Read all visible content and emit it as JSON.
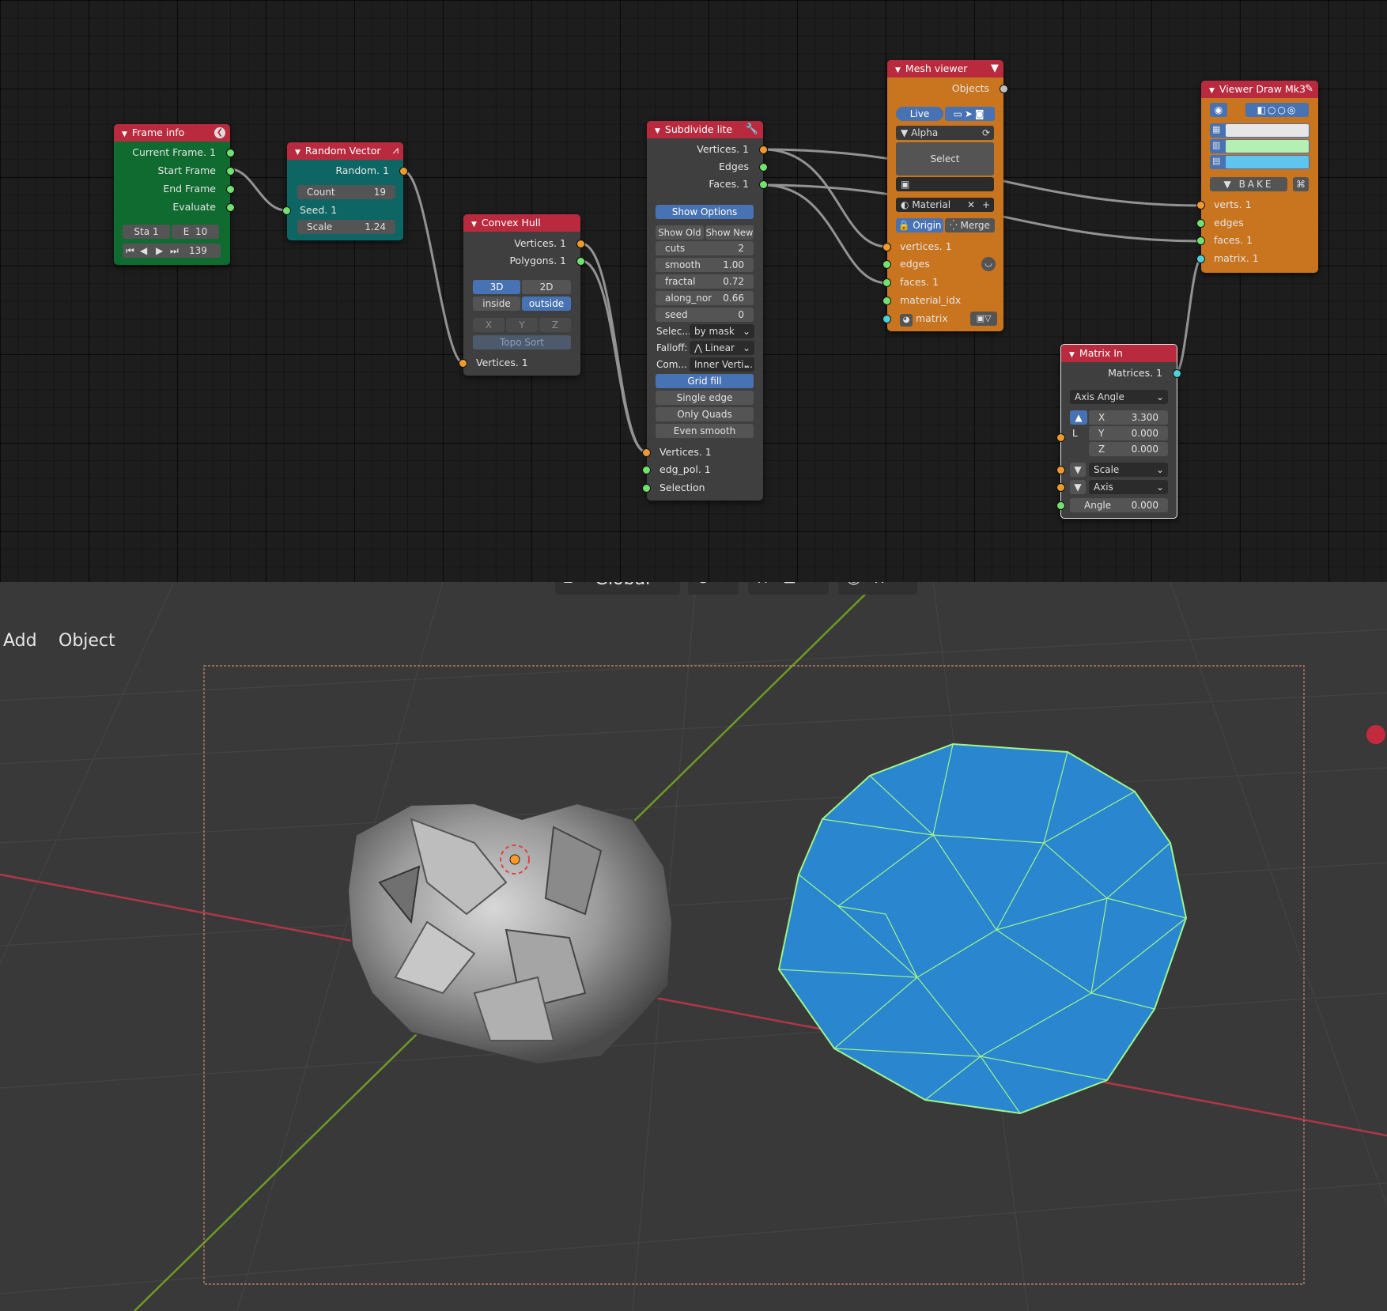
{
  "nodes": {
    "frame_info": {
      "title": "Frame info",
      "outputs": [
        "Current Frame. 1",
        "Start Frame",
        "End Frame",
        "Evaluate"
      ],
      "start_label": "Sta",
      "start_value": "1",
      "end_label": "E",
      "end_value": "10",
      "frame_value": "139"
    },
    "random_vector": {
      "title": "Random Vector",
      "output": "Random. 1",
      "count_label": "Count",
      "count_value": "19",
      "seed": "Seed. 1",
      "scale_label": "Scale",
      "scale_value": "1.24"
    },
    "convex_hull": {
      "title": "Convex Hull",
      "outputs": [
        "Vertices. 1",
        "Polygons. 1"
      ],
      "mode_3d": "3D",
      "mode_2d": "2D",
      "inside": "inside",
      "outside": "outside",
      "axes": [
        "X",
        "Y",
        "Z"
      ],
      "topo_sort": "Topo Sort",
      "input": "Vertices. 1"
    },
    "subdivide": {
      "title": "Subdivide lite",
      "outputs": [
        "Vertices. 1",
        "Edges",
        "Faces. 1"
      ],
      "show_options": "Show Options",
      "show_old": "Show Old",
      "show_new": "Show New",
      "params": [
        {
          "label": "cuts",
          "value": "2"
        },
        {
          "label": "smooth",
          "value": "1.00"
        },
        {
          "label": "fractal",
          "value": "0.72"
        },
        {
          "label": "along_nor",
          "value": "0.66"
        },
        {
          "label": "seed",
          "value": "0"
        }
      ],
      "select_label": "Selec...",
      "select_value": "by mask",
      "falloff_label": "Falloff:",
      "falloff_value": "Linear",
      "corner_label": "Com...",
      "corner_value": "Inner Verti...",
      "modes": [
        "Grid fill",
        "Single edge",
        "Only Quads",
        "Even smooth"
      ],
      "inputs": [
        "Vertices. 1",
        "edg_pol. 1",
        "Selection"
      ]
    },
    "mesh_viewer": {
      "title": "Mesh viewer",
      "output": "Objects",
      "live": "Live",
      "alpha": "Alpha",
      "select": "Select",
      "material": "Material",
      "origin": "Origin",
      "merge": "Merge",
      "inputs": [
        "vertices. 1",
        "edges",
        "faces. 1",
        "material_idx",
        "matrix"
      ]
    },
    "viewer_draw": {
      "title": "Viewer Draw Mk3",
      "bake": "BAKE",
      "swatches": [
        "#e6e6e6",
        "#b4f0b4",
        "#5fc4ee"
      ],
      "inputs": [
        "verts. 1",
        "edges",
        "faces. 1",
        "matrix. 1"
      ]
    },
    "matrix_in": {
      "title": "Matrix In",
      "output": "Matrices. 1",
      "mode": "Axis Angle",
      "loc_label": "L",
      "x_label": "X",
      "x_value": "3.300",
      "y_label": "Y",
      "y_value": "0.000",
      "z_label": "Z",
      "z_value": "0.000",
      "scale": "Scale",
      "axis": "Axis",
      "angle_label": "Angle",
      "angle_value": "0.000"
    }
  },
  "viewport": {
    "transform_orientation": "Global",
    "menu": [
      "Add",
      "Object"
    ]
  },
  "colors": {
    "frame_info": "#0f6b2f",
    "random_vector": "#0d6663",
    "mesh_viewer": "#c9741e",
    "viewer_draw": "#c9741e",
    "header_red": "#b92a3e",
    "hull_blue": "#2a86cf",
    "hull_wire": "#9ff58a"
  }
}
